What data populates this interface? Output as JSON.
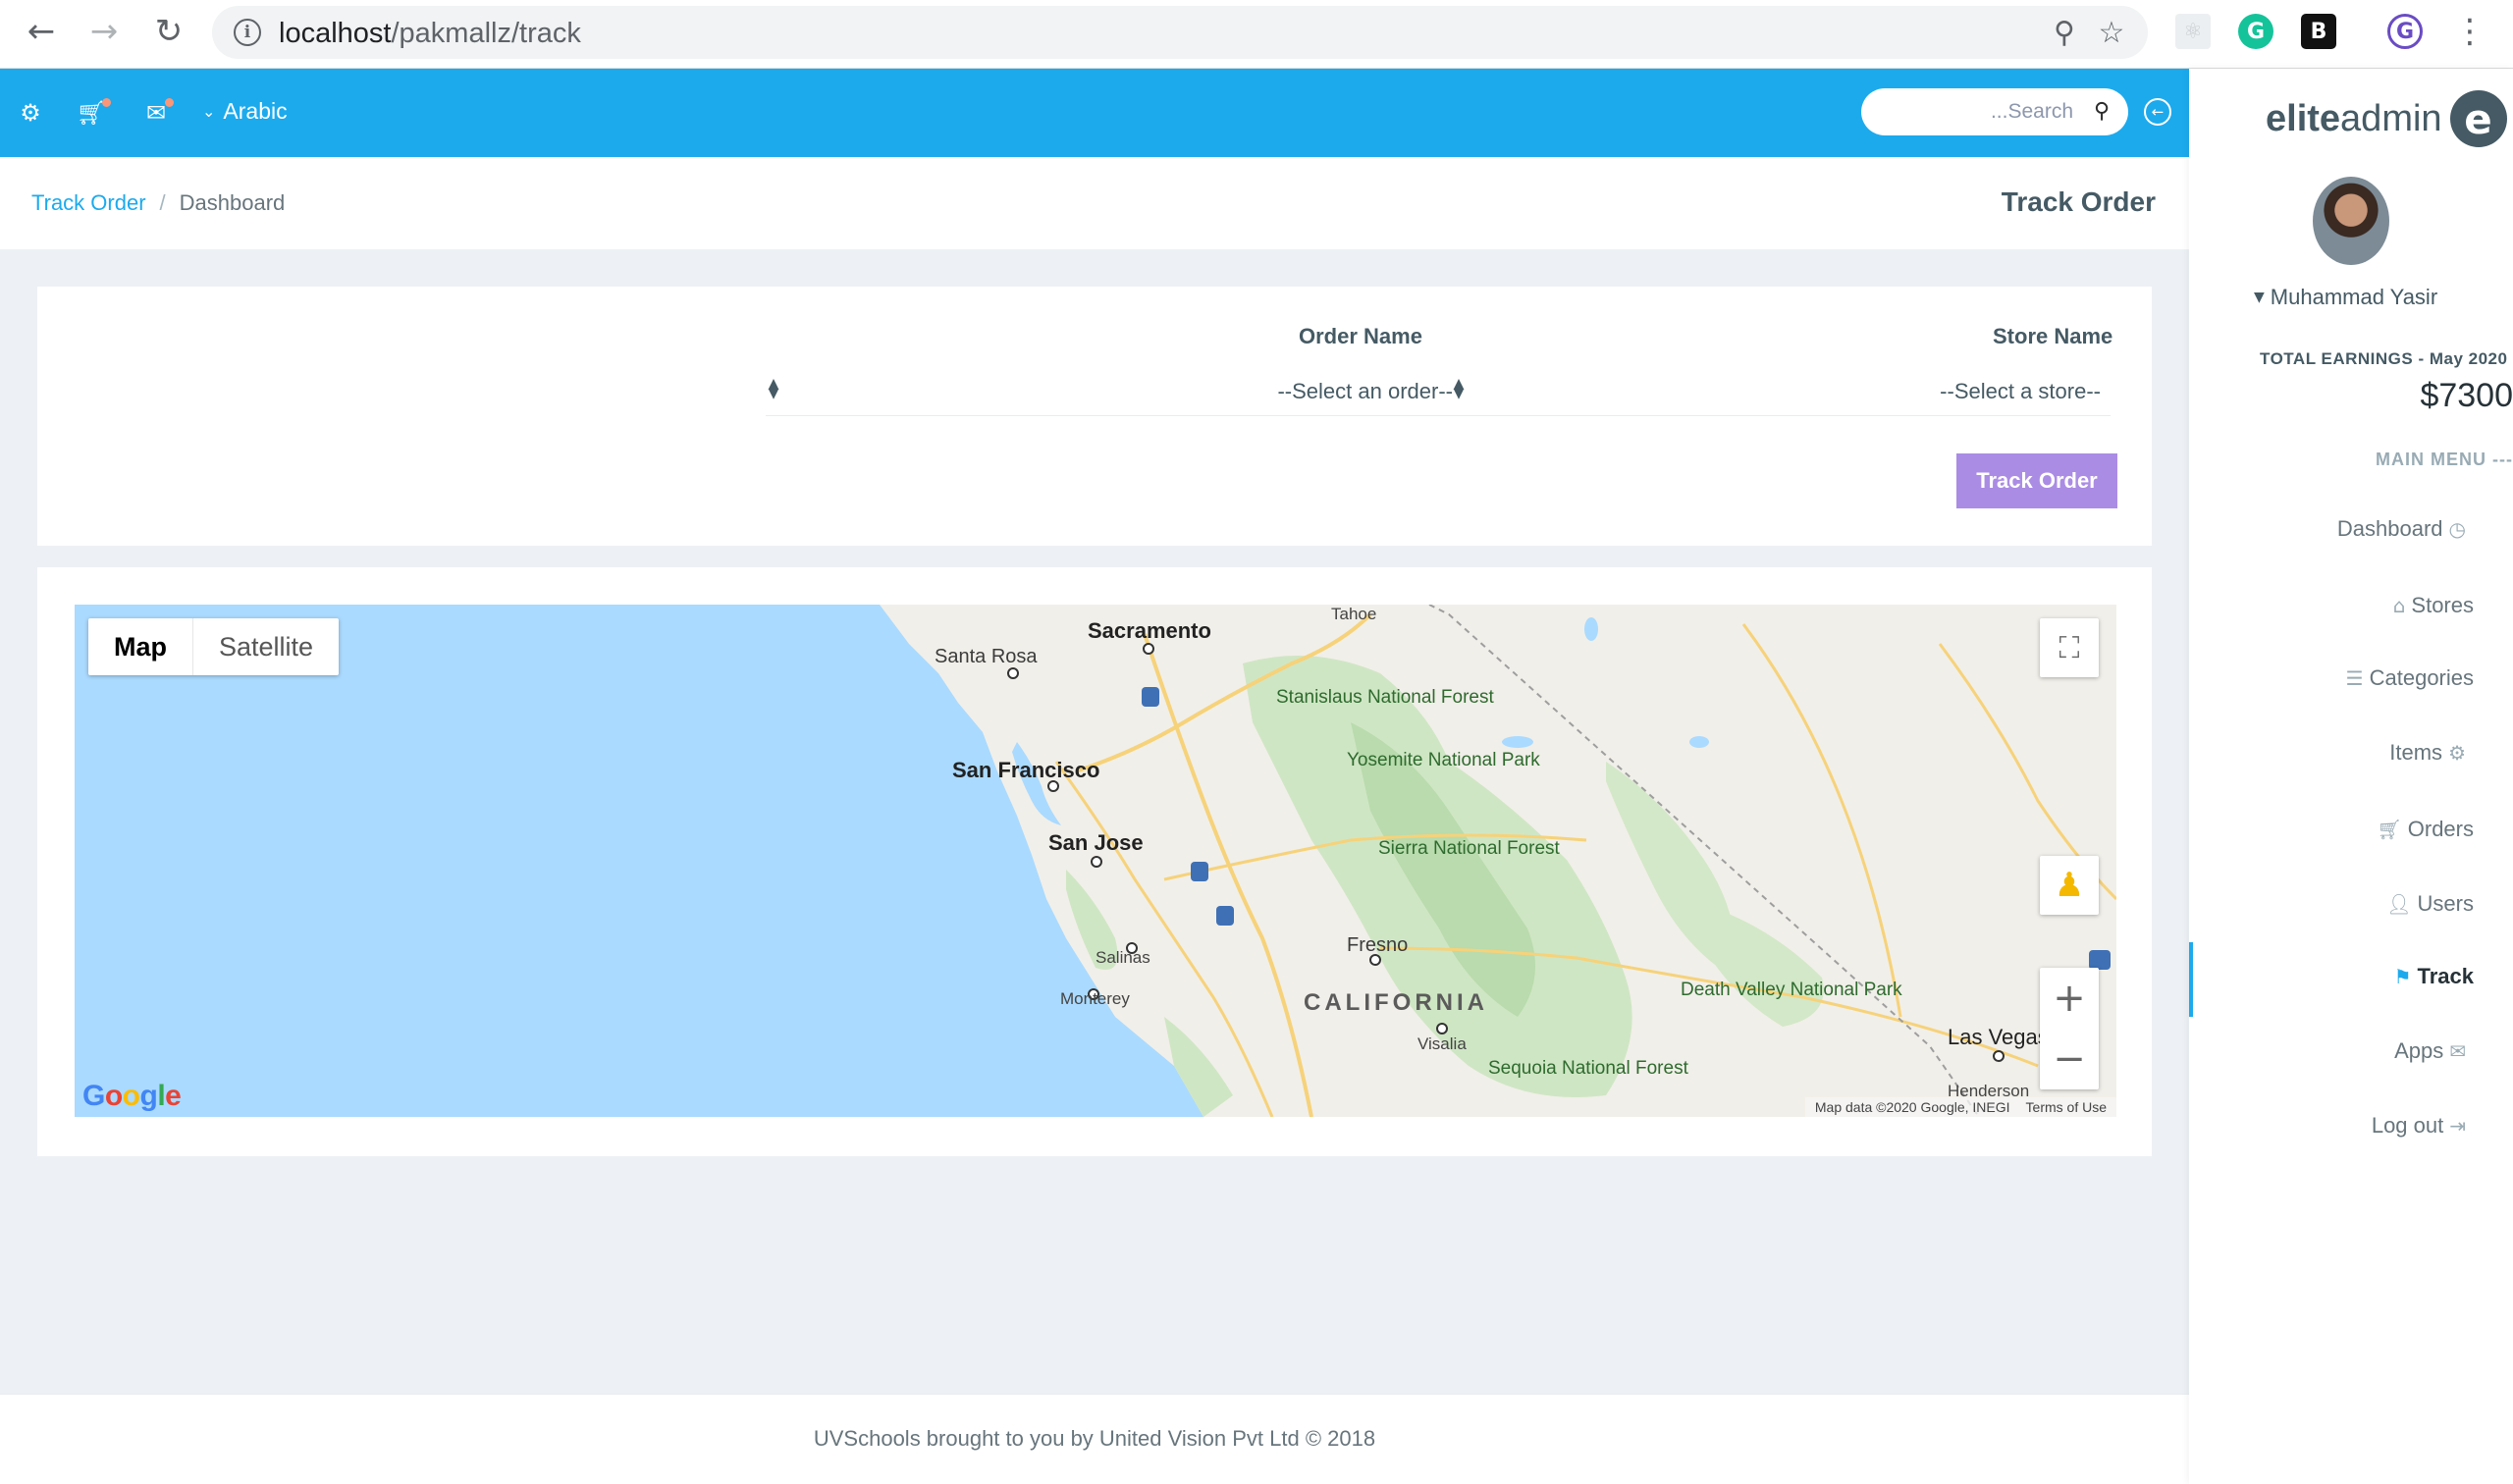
{
  "browser": {
    "url_host": "localhost",
    "url_path": "/pakmallz/track"
  },
  "topbar": {
    "language": "Arabic",
    "search_placeholder": "...Search"
  },
  "breadcrumb": {
    "items": [
      "Track Order",
      "Dashboard"
    ],
    "separator": "/"
  },
  "page_title": "Track Order",
  "form": {
    "order_label": "Order Name",
    "order_value": "--Select an order--",
    "store_label": "Store Name",
    "store_value": "--Select a store--",
    "submit_label": "Track Order"
  },
  "map": {
    "type_map": "Map",
    "type_satellite": "Satellite",
    "attribution": "Map data ©2020 Google, INEGI",
    "terms": "Terms of Use",
    "logo": "Google",
    "labels": {
      "sacramento": "Sacramento",
      "santa_rosa": "Santa Rosa",
      "tahoe": "Tahoe",
      "stanislaus": "Stanislaus National Forest",
      "yosemite": "Yosemite National Park",
      "san_francisco": "San Francisco",
      "san_jose": "San Jose",
      "sierra": "Sierra National Forest",
      "salinas": "Salinas",
      "monterey": "Monterey",
      "fresno": "Fresno",
      "california": "CALIFORNIA",
      "visalia": "Visalia",
      "sequoia": "Sequoia National Forest",
      "death_valley": "Death Valley National Park",
      "las_vegas": "Las Vegas",
      "henderson": "Henderson"
    }
  },
  "footer": {
    "text": "UVSchools brought to you by United Vision Pvt Ltd © 2018"
  },
  "sidebar": {
    "brand_bold": "elite",
    "brand_light": "admin",
    "user_name": "Muhammad Yasir",
    "earnings_label": "TOTAL EARNINGS - May 2020",
    "earnings_value": "$7300",
    "menu_heading": "MAIN MENU ---",
    "menu": [
      {
        "label": "Dashboard",
        "icon": "speedometer-icon"
      },
      {
        "label": "Stores",
        "icon": "home-icon"
      },
      {
        "label": "Categories",
        "icon": "list-icon"
      },
      {
        "label": "Items",
        "icon": "gear-icon"
      },
      {
        "label": "Orders",
        "icon": "cart-icon"
      },
      {
        "label": "Users",
        "icon": "user-icon"
      },
      {
        "label": "Track",
        "icon": "signpost-icon",
        "active": true
      },
      {
        "label": "Apps",
        "icon": "envelope-icon"
      },
      {
        "label": "Log out",
        "icon": "logout-icon"
      }
    ]
  },
  "colors": {
    "accent": "#1caaed",
    "button": "#ab8ce4",
    "notify_dot": "#fb9678"
  }
}
